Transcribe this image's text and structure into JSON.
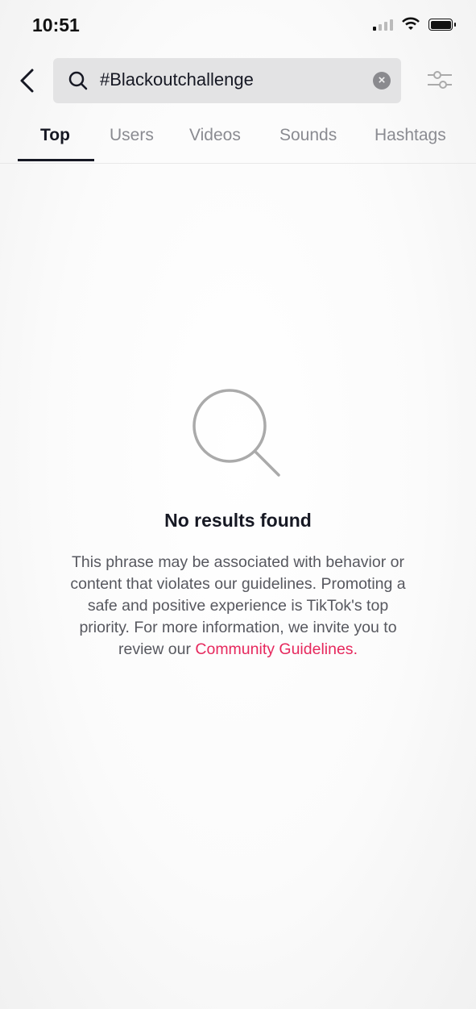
{
  "status_bar": {
    "time": "10:51",
    "signal_bars_active": 1,
    "signal_bars_total": 4,
    "battery_level": 1.0
  },
  "search": {
    "query": "#Blackoutchallenge"
  },
  "tabs": [
    {
      "label": "Top",
      "active": true
    },
    {
      "label": "Users",
      "active": false
    },
    {
      "label": "Videos",
      "active": false
    },
    {
      "label": "Sounds",
      "active": false
    },
    {
      "label": "Hashtags",
      "active": false
    }
  ],
  "empty_state": {
    "title": "No results found",
    "message_lines": [
      "This phrase may be associated with behavior or",
      "content that violates our guidelines. Promoting a",
      "safe and positive experience is TikTok's top",
      "priority. For more information, we invite you to",
      "review our "
    ],
    "link_label": "Community Guidelines",
    "after_link": "."
  },
  "colors": {
    "accent": "#e6285d",
    "text": "#161823",
    "muted": "#8a8b91"
  },
  "icons": [
    "back-chevron-icon",
    "search-icon",
    "clear-icon",
    "filter-sliders-icon",
    "magnifier-empty-icon"
  ]
}
